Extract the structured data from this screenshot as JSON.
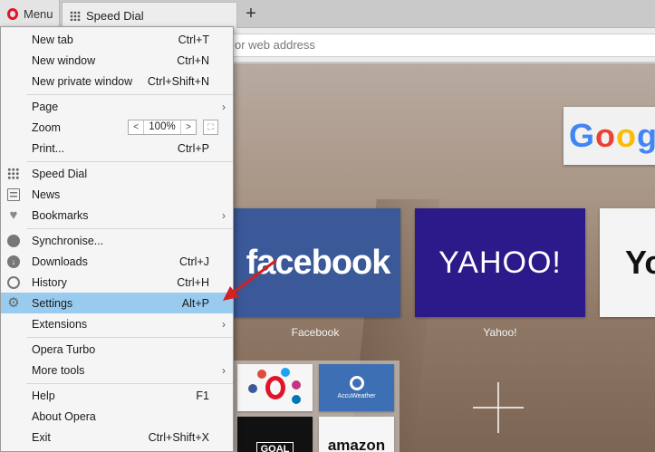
{
  "tabbar": {
    "menu_label": "Menu",
    "tab_title": "Speed Dial",
    "new_tab_symbol": "+"
  },
  "address_bar": {
    "text": "or web address"
  },
  "speed_dial": {
    "tiles": [
      {
        "name": "google",
        "logo": "Goog"
      },
      {
        "name": "facebook",
        "logo": "facebook",
        "label": "Facebook"
      },
      {
        "name": "yahoo",
        "logo": "YAHOO!",
        "label": "Yahoo!"
      },
      {
        "name": "partial",
        "logo": "Yo"
      }
    ],
    "folder": {
      "accu_text": "AccuWeather",
      "goal_text": "GOAL",
      "amazon_text": "amazon"
    },
    "add_symbol": "+"
  },
  "menu": {
    "items": [
      {
        "label": "New tab",
        "shortcut": "Ctrl+T"
      },
      {
        "label": "New window",
        "shortcut": "Ctrl+N"
      },
      {
        "label": "New private window",
        "shortcut": "Ctrl+Shift+N"
      },
      {
        "label": "Page",
        "shortcut": "",
        "submenu": true
      },
      {
        "label": "Zoom",
        "shortcut": ""
      },
      {
        "label": "Print...",
        "shortcut": "Ctrl+P"
      },
      {
        "label": "Speed Dial",
        "shortcut": "",
        "icon": "grid-icon"
      },
      {
        "label": "News",
        "shortcut": "",
        "icon": "news-icon"
      },
      {
        "label": "Bookmarks",
        "shortcut": "",
        "icon": "heart-icon",
        "submenu": true
      },
      {
        "label": "Synchronise...",
        "shortcut": "",
        "icon": "account-icon"
      },
      {
        "label": "Downloads",
        "shortcut": "Ctrl+J",
        "icon": "download-icon"
      },
      {
        "label": "History",
        "shortcut": "Ctrl+H",
        "icon": "clock-icon"
      },
      {
        "label": "Settings",
        "shortcut": "Alt+P",
        "icon": "gear-icon",
        "highlighted": true
      },
      {
        "label": "Extensions",
        "shortcut": "",
        "submenu": true
      },
      {
        "label": "Opera Turbo",
        "shortcut": ""
      },
      {
        "label": "More tools",
        "shortcut": "",
        "submenu": true
      },
      {
        "label": "Help",
        "shortcut": "F1"
      },
      {
        "label": "About Opera",
        "shortcut": ""
      },
      {
        "label": "Exit",
        "shortcut": "Ctrl+Shift+X"
      }
    ],
    "zoom": {
      "value": "100%",
      "decrease": "<",
      "increase": ">",
      "fullscreen": "⛶"
    },
    "submenu_arrow": "›"
  },
  "colors": {
    "highlight": "#99cbef",
    "opera_red": "#e0152a",
    "annotation_arrow": "#d42020"
  }
}
